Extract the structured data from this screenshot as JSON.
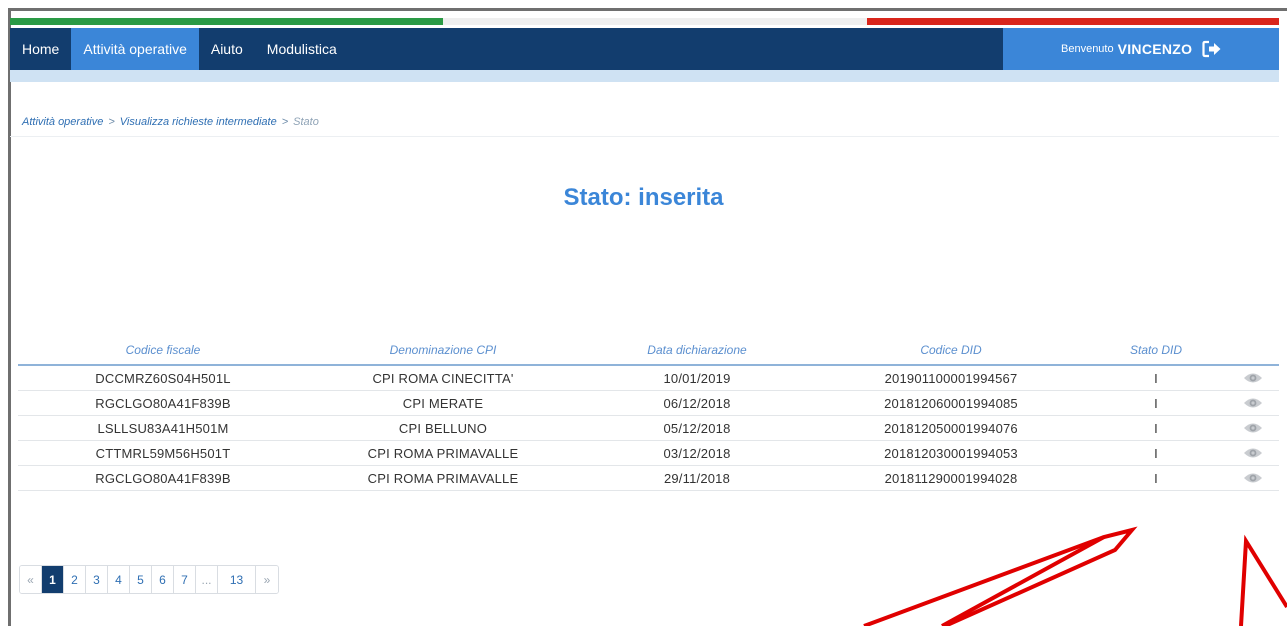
{
  "nav": {
    "items": [
      {
        "label": "Home"
      },
      {
        "label": "Attività operative"
      },
      {
        "label": "Aiuto"
      },
      {
        "label": "Modulistica"
      }
    ],
    "welcome_prefix": "Benvenuto",
    "user_name": "VINCENZO"
  },
  "breadcrumb": {
    "items": [
      "Attività operative",
      "Visualizza richieste intermediate",
      "Stato"
    ],
    "separator": ">"
  },
  "page_title": "Stato: inserita",
  "table": {
    "headers": [
      "Codice fiscale",
      "Denominazione CPI",
      "Data dichiarazione",
      "Codice DID",
      "Stato DID"
    ],
    "rows": [
      [
        "DCCMRZ60S04H501L",
        "CPI ROMA CINECITTA'",
        "10/01/2019",
        "201901100001994567",
        "I"
      ],
      [
        "RGCLGO80A41F839B",
        "CPI MERATE",
        "06/12/2018",
        "201812060001994085",
        "I"
      ],
      [
        "LSLLSU83A41H501M",
        "CPI BELLUNO",
        "05/12/2018",
        "201812050001994076",
        "I"
      ],
      [
        "CTTMRL59M56H501T",
        "CPI ROMA PRIMAVALLE",
        "03/12/2018",
        "201812030001994053",
        "I"
      ],
      [
        "RGCLGO80A41F839B",
        "CPI ROMA PRIMAVALLE",
        "29/11/2018",
        "201811290001994028",
        "I"
      ]
    ]
  },
  "pagination": {
    "prev": "«",
    "pages": [
      "1",
      "2",
      "3",
      "4",
      "5",
      "6",
      "7",
      "...",
      "13"
    ],
    "next": "»",
    "current": "1"
  },
  "colors": {
    "nav_bg": "#123d6e",
    "accent": "#3b86d8",
    "annotation": "#e00000"
  },
  "icons": {
    "logout": "logout-icon",
    "view": "eye-icon"
  }
}
